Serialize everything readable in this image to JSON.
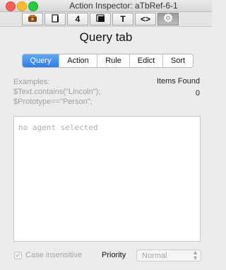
{
  "window": {
    "title": "Action Inspector: aTbRef-6-1"
  },
  "toolbar": {
    "items": [
      {
        "icon": "color-palette-icon"
      },
      {
        "icon": "document-icon"
      },
      {
        "icon": "calendar-icon",
        "label": "4"
      },
      {
        "icon": "window-icon"
      },
      {
        "icon": "text-icon",
        "label": "T"
      },
      {
        "icon": "code-icon",
        "label": "<>"
      },
      {
        "icon": "gear-icon",
        "active": true
      }
    ]
  },
  "heading": "Query tab",
  "tabs": [
    {
      "label": "Query",
      "selected": true
    },
    {
      "label": "Action"
    },
    {
      "label": "Rule"
    },
    {
      "label": "Edict"
    },
    {
      "label": "Sort"
    }
  ],
  "examples": {
    "title": "Examples:",
    "line1": "$Text.contains(\"Lincoln\");",
    "line2": "$Prototype==\"Person\";"
  },
  "items_found": {
    "label": "Items Found",
    "count": "0"
  },
  "query": {
    "placeholder": "no agent selected"
  },
  "options": {
    "case_insensitive_label": "Case insensitive",
    "case_insensitive_checked": true,
    "priority_label": "Priority",
    "priority_value": "Normal"
  },
  "colors": {
    "accent": "#2e7de8",
    "close": "#fc5f57",
    "minimize": "#fdbc2e",
    "maximize": "#28c840"
  }
}
